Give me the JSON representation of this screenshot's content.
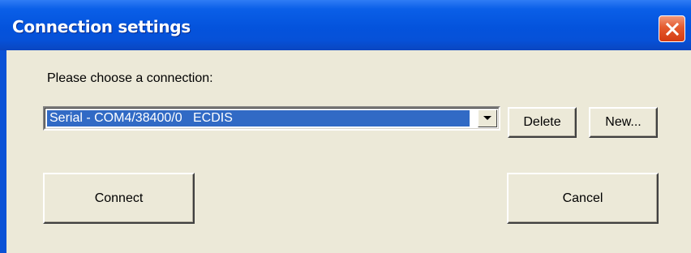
{
  "window": {
    "title": "Connection settings",
    "close_icon": "close-icon",
    "colors": {
      "titlebar": "#0453dc",
      "client_background": "#ece9d8",
      "selection": "#316ac5",
      "close_button": "#e45a2e"
    }
  },
  "form": {
    "prompt_label": "Please choose a connection:",
    "connection_select": {
      "selected_value": "Serial - COM4/38400/0   ECDIS",
      "dropdown_icon": "dropdown-arrow-icon"
    },
    "delete_label": "Delete",
    "new_label": "New..."
  },
  "actions": {
    "connect_label": "Connect",
    "cancel_label": "Cancel"
  }
}
